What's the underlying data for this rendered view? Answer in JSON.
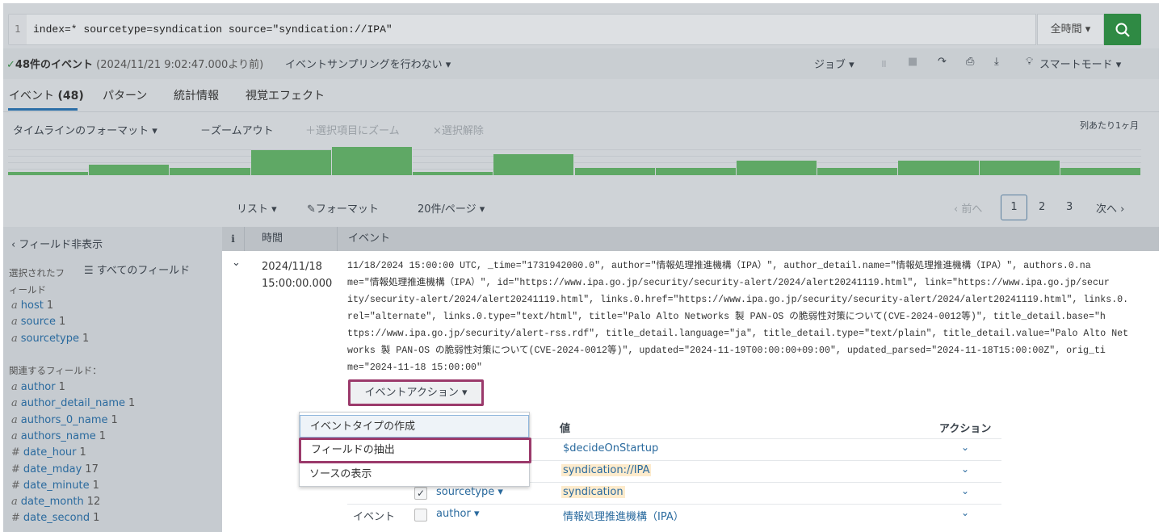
{
  "search": {
    "line_number": "1",
    "query": "index=* sourcetype=syndication source=\"syndication://IPA\"",
    "time_range": "全時間 ▾",
    "search_icon": "magnifier-icon"
  },
  "status": {
    "check": "✓",
    "count": "48件のイベント",
    "since": "(2024/11/21 9:02:47.000より前)",
    "sampling": "イベントサンプリングを行わない ▾",
    "job": "ジョブ ▾",
    "mode": "スマートモード ▾"
  },
  "tabs": [
    {
      "label": "イベント",
      "count": "(48)",
      "active": true
    },
    {
      "label": "パターン"
    },
    {
      "label": "統計情報"
    },
    {
      "label": "視覚エフェクト"
    }
  ],
  "timeline": {
    "format": "タイムラインのフォーマット ▾",
    "zoom_out": "－ズームアウト",
    "zoom_selection": "＋選択項目にズーム",
    "deselect": "×選択解除",
    "scale": "列あたり1ヶ月",
    "color": "#5fa865"
  },
  "chart_data": {
    "type": "bar",
    "values": [
      1,
      3,
      2,
      7,
      8,
      1,
      6,
      2,
      2,
      4,
      2,
      4,
      4,
      2
    ]
  },
  "results_bar": {
    "list": "リスト ▾",
    "format": "フォーマット",
    "per_page": "20件/ページ ▾",
    "prev": "‹ 前へ",
    "pages": [
      "1",
      "2",
      "3"
    ],
    "current_page": "1",
    "next": "次へ ›"
  },
  "sidebar": {
    "hide_fields": "‹ フィールド非表示",
    "all_fields": "すべてのフィールド",
    "selected_label_1": "選択されたフ",
    "selected_label_2": "ィールド",
    "selected": [
      {
        "type": "a",
        "name": "host",
        "count": "1"
      },
      {
        "type": "a",
        "name": "source",
        "count": "1"
      },
      {
        "type": "a",
        "name": "sourcetype",
        "count": "1"
      }
    ],
    "interesting_label": "関連するフィールド：",
    "interesting": [
      {
        "type": "a",
        "name": "author",
        "count": "1"
      },
      {
        "type": "a",
        "name": "author_detail_name",
        "count": "1"
      },
      {
        "type": "a",
        "name": "authors_0_name",
        "count": "1"
      },
      {
        "type": "a",
        "name": "authors_name",
        "count": "1"
      },
      {
        "type": "#",
        "name": "date_hour",
        "count": "1"
      },
      {
        "type": "#",
        "name": "date_mday",
        "count": "17"
      },
      {
        "type": "#",
        "name": "date_minute",
        "count": "1"
      },
      {
        "type": "a",
        "name": "date_month",
        "count": "12"
      },
      {
        "type": "#",
        "name": "date_second",
        "count": "1"
      }
    ]
  },
  "table": {
    "col_i": "i",
    "col_time": "時間",
    "col_event": "イベント"
  },
  "event": {
    "date": "2024/11/18",
    "time": "15:00:00.000",
    "raw_lines": [
      "11/18/2024 15:00:00 UTC, _time=\"1731942000.0\", author=\"情報処理推進機構（IPA）\", author_detail.name=\"情報処理推進機構（IPA）\", authors.0.na",
      "me=\"情報処理推進機構（IPA）\", id=\"https://www.ipa.go.jp/security/security-alert/2024/alert20241119.html\", link=\"https://www.ipa.go.jp/secur",
      "ity/security-alert/2024/alert20241119.html\", links.0.href=\"https://www.ipa.go.jp/security/security-alert/2024/alert20241119.html\", links.0.",
      "rel=\"alternate\", links.0.type=\"text/html\", title=\"Palo Alto Networks 製 PAN-OS の脆弱性対策について(CVE-2024-0012等)\", title_detail.base=\"h",
      "ttps://www.ipa.go.jp/security/alert-rss.rdf\", title_detail.language=\"ja\", title_detail.type=\"text/plain\", title_detail.value=\"Palo Alto Net",
      "works 製 PAN-OS の脆弱性対策について(CVE-2024-0012等)\", updated=\"2024-11-19T00:00:00+09:00\", updated_parsed=\"2024-11-18T15:00:00Z\", orig_ti",
      "me=\"2024-11-18 15:00:00\""
    ],
    "actions_button": "イベントアクション ▾",
    "menu": [
      "イベントタイプの作成",
      "フィールドの抽出",
      "ソースの表示"
    ],
    "fields_header": {
      "value": "値",
      "action": "アクション"
    },
    "fields": [
      {
        "value": "$decideOnStartup"
      },
      {
        "value": "syndication://IPA",
        "highlight": true
      },
      {
        "group": "",
        "checked": true,
        "name": "sourcetype ▾",
        "value": "syndication",
        "highlight": true
      },
      {
        "group": "イベント",
        "checked": false,
        "name": "author ▾",
        "value": "情報処理推進機構（IPA）"
      }
    ]
  },
  "highlight_color": "#9b3a6b"
}
